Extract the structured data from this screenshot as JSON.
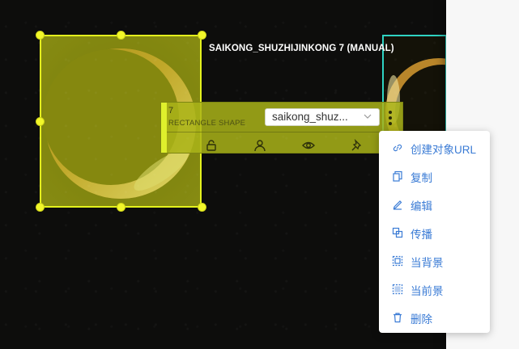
{
  "shape_title": "SAIKONG_SHUZHIJINKONG 7 (MANUAL)",
  "toolbar": {
    "index": "7",
    "type": "RECTANGLE SHAPE",
    "label_value": "saikong_shuz...",
    "icons": [
      "lock-icon",
      "user-icon",
      "eye-icon",
      "pin-icon"
    ]
  },
  "context_menu": {
    "items": [
      {
        "label": "创建对象URL",
        "icon": "link-icon"
      },
      {
        "label": "复制",
        "icon": "copy-icon"
      },
      {
        "label": "编辑",
        "icon": "edit-icon"
      },
      {
        "label": "传播",
        "icon": "propagate-icon"
      },
      {
        "label": "当背景",
        "icon": "to-background-icon"
      },
      {
        "label": "当前景",
        "icon": "to-foreground-icon"
      },
      {
        "label": "删除",
        "icon": "delete-icon"
      }
    ]
  },
  "colors": {
    "selection": "#e4f21d",
    "second_box": "#2fd3c2",
    "menu_text": "#3a7bd5"
  }
}
